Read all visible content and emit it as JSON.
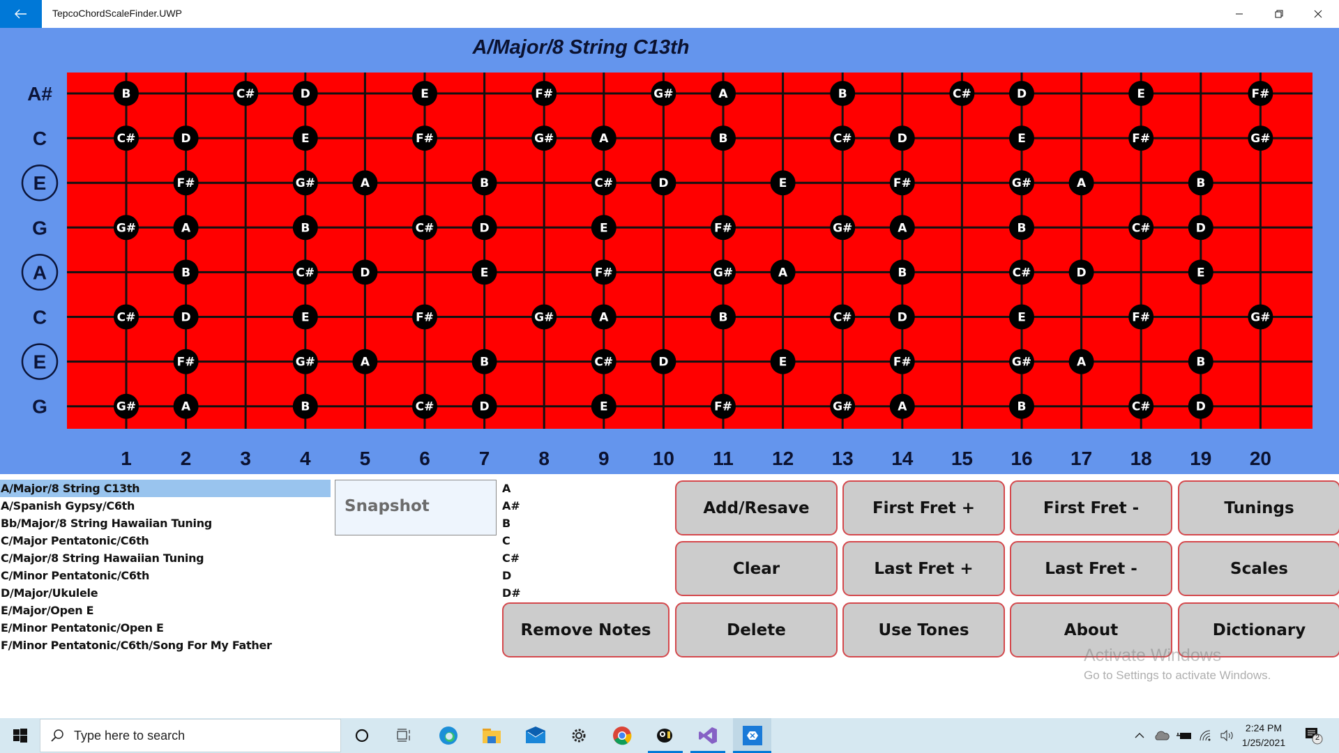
{
  "window": {
    "title": "TepcoChordScaleFinder.UWP",
    "back_icon": "back-arrow-icon",
    "controls": [
      "minimize-icon",
      "restore-icon",
      "close-icon"
    ]
  },
  "fretboard": {
    "title": "A/Major/8 String C13th",
    "colors": {
      "board": "#ff0000",
      "background": "#6495ed",
      "dot": "#000000",
      "dot_text": "#ffffff"
    },
    "fret_numbers": [
      "1",
      "2",
      "3",
      "4",
      "5",
      "6",
      "7",
      "8",
      "9",
      "10",
      "11",
      "12",
      "13",
      "14",
      "15",
      "16",
      "17",
      "18",
      "19",
      "20"
    ],
    "strings": [
      {
        "label": "A#",
        "circled": false,
        "notes": [
          "B",
          "",
          "C#",
          "D",
          "",
          "E",
          "",
          "F#",
          "",
          "G#",
          "A",
          "",
          "B",
          "",
          "C#",
          "D",
          "",
          "E",
          "",
          "F#"
        ]
      },
      {
        "label": "C",
        "circled": false,
        "notes": [
          "C#",
          "D",
          "",
          "E",
          "",
          "F#",
          "",
          "G#",
          "A",
          "",
          "B",
          "",
          "C#",
          "D",
          "",
          "E",
          "",
          "F#",
          "",
          "G#"
        ]
      },
      {
        "label": "E",
        "circled": true,
        "notes": [
          "",
          "F#",
          "",
          "G#",
          "A",
          "",
          "B",
          "",
          "C#",
          "D",
          "",
          "E",
          "",
          "F#",
          "",
          "G#",
          "A",
          "",
          "B",
          ""
        ]
      },
      {
        "label": "G",
        "circled": false,
        "notes": [
          "G#",
          "A",
          "",
          "B",
          "",
          "C#",
          "D",
          "",
          "E",
          "",
          "F#",
          "",
          "G#",
          "A",
          "",
          "B",
          "",
          "C#",
          "D",
          ""
        ]
      },
      {
        "label": "A",
        "circled": true,
        "notes": [
          "",
          "B",
          "",
          "C#",
          "D",
          "",
          "E",
          "",
          "F#",
          "",
          "G#",
          "A",
          "",
          "B",
          "",
          "C#",
          "D",
          "",
          "E",
          ""
        ]
      },
      {
        "label": "C",
        "circled": false,
        "notes": [
          "C#",
          "D",
          "",
          "E",
          "",
          "F#",
          "",
          "G#",
          "A",
          "",
          "B",
          "",
          "C#",
          "D",
          "",
          "E",
          "",
          "F#",
          "",
          "G#"
        ]
      },
      {
        "label": "E",
        "circled": true,
        "notes": [
          "",
          "F#",
          "",
          "G#",
          "A",
          "",
          "B",
          "",
          "C#",
          "D",
          "",
          "E",
          "",
          "F#",
          "",
          "G#",
          "A",
          "",
          "B",
          ""
        ]
      },
      {
        "label": "G",
        "circled": false,
        "notes": [
          "G#",
          "A",
          "",
          "B",
          "",
          "C#",
          "D",
          "",
          "E",
          "",
          "F#",
          "",
          "G#",
          "A",
          "",
          "B",
          "",
          "C#",
          "D",
          ""
        ]
      }
    ]
  },
  "saved_list": {
    "selected_index": 0,
    "items": [
      "A/Major/8 String C13th",
      "A/Spanish Gypsy/C6th",
      "Bb/Major/8 String Hawaiian Tuning",
      "C/Major Pentatonic/C6th",
      "C/Major/8 String Hawaiian Tuning",
      "C/Minor Pentatonic/C6th",
      "D/Major/Ukulele",
      "E/Major/Open E",
      "E/Minor Pentatonic/Open E",
      "F/Minor Pentatonic/C6th/Song For My Father"
    ]
  },
  "snapshot": {
    "placeholder": "Snapshot"
  },
  "note_list": [
    "A",
    "A#",
    "B",
    "C",
    "C#",
    "D",
    "D#"
  ],
  "buttons": {
    "add_resave": "Add/Resave",
    "first_fret_plus": "First Fret +",
    "first_fret_minus": "First Fret -",
    "tunings": "Tunings",
    "clear": "Clear",
    "last_fret_plus": "Last Fret +",
    "last_fret_minus": "Last Fret -",
    "scales": "Scales",
    "remove_notes": "Remove Notes",
    "delete": "Delete",
    "use_tones": "Use Tones",
    "about": "About",
    "dictionary": "Dictionary"
  },
  "watermark": {
    "line1": "Activate Windows",
    "line2": "Go to Settings to activate Windows."
  },
  "taskbar": {
    "search_placeholder": "Type here to search",
    "apps": [
      "cortana-icon",
      "task-view-icon",
      "edge-icon",
      "file-explorer-icon",
      "mail-icon",
      "settings-icon",
      "chrome-icon",
      "bee-app-icon",
      "visual-studio-icon",
      "xamarin-app-icon"
    ],
    "time": "2:24 PM",
    "date": "1/25/2021",
    "notification_count": "2"
  }
}
